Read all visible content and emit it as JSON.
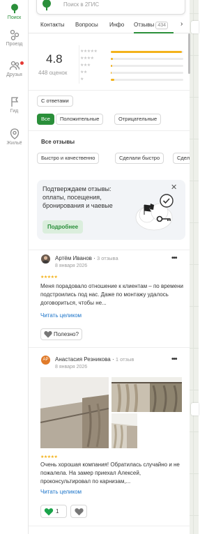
{
  "rail": {
    "items": [
      {
        "label": "Поиск",
        "icon": "search-icon"
      },
      {
        "label": "Проезд",
        "icon": "route-icon"
      },
      {
        "label": "Друзья",
        "icon": "friends-icon"
      },
      {
        "label": "Гид",
        "icon": "guide-flag-icon"
      },
      {
        "label": "Жильё",
        "icon": "housing-icon"
      }
    ]
  },
  "search": {
    "placeholder": "Поиск в 2ГИС"
  },
  "tabs": {
    "items": [
      "Контакты",
      "Вопросы",
      "Инфо",
      "Отзывы"
    ],
    "reviews_count": "434",
    "active": "Отзывы"
  },
  "rating": {
    "value": "4.8",
    "count_label": "448 оценок",
    "distribution_fractions": [
      0.98,
      0.03,
      0.02,
      0.01,
      0.05
    ]
  },
  "filters": {
    "with_answers": "С ответами",
    "all": "Все",
    "positive": "Положительные",
    "negative": "Отрицательные"
  },
  "all_reviews_title": "Все отзывы",
  "tag_chips": [
    "Быстро и качественно",
    "Сделали быстро",
    "Сдел"
  ],
  "promo": {
    "text": "Подтверждаем отзывы: оплаты, посещения, бронирования и чаевые",
    "button": "Подробнее"
  },
  "reviews": [
    {
      "author": "Артём Иванов",
      "count": "3 отзыва",
      "date": "8 января 2026",
      "rating": 5,
      "text": "Меня порадовало отношение к клиентам – по времени подстроились под нас. Даже по монтажу удалось договориться, чтобы не...",
      "read_more": "Читать целиком",
      "useful_label": "Полезно?"
    },
    {
      "author": "Анастасия Резникова",
      "avatar_initials": "АР",
      "count": "1 отзыв",
      "date": "8 января 2026",
      "rating": 5,
      "text": "Очень хорошая компания! Обратилась случайно и не пожалела. На замер приехал Алексей, проконсультировал по карнизам,...",
      "read_more": "Читать целиком",
      "likes": "1"
    }
  ],
  "colors": {
    "accent_green": "#2a8f3a",
    "star_yellow": "#f3b21b",
    "link_blue": "#1a73c9",
    "avatar_orange": "#e07b2a"
  }
}
